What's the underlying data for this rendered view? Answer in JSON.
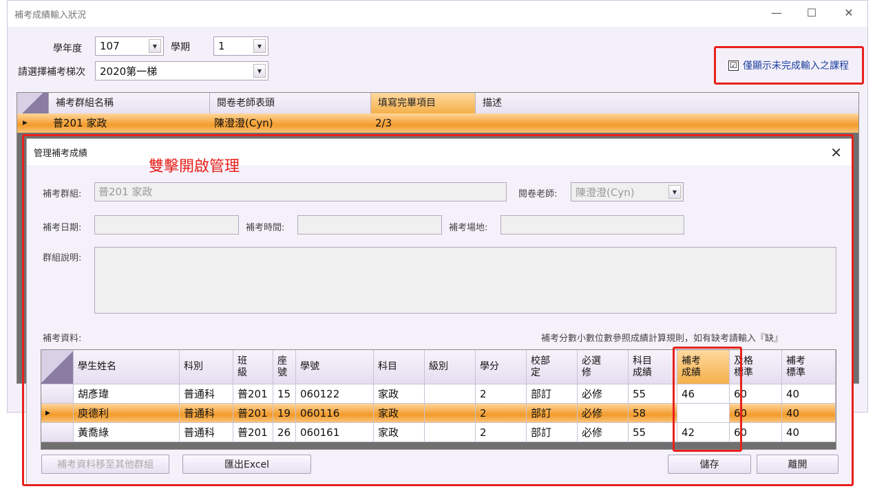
{
  "window": {
    "title": "補考成績輸入狀況",
    "minimize": "—",
    "maximize": "☐",
    "close": "✕"
  },
  "filters": {
    "year_label": "學年度",
    "year_value": "107",
    "semester_label": "學期",
    "semester_value": "1",
    "batch_label": "請選擇補考梯次",
    "batch_value": "2020第一梯",
    "only_incomplete_label": "僅顯示未完成輸入之課程",
    "only_incomplete_checked": "☑"
  },
  "outer_grid": {
    "columns": [
      "補考群組名稱",
      "閱卷老師表頭",
      "填寫完畢項目",
      "描述"
    ],
    "rows": [
      {
        "group": "普201 家政",
        "teacher": "陳澄澄(Cyn)",
        "done": "2/3",
        "desc": ""
      }
    ]
  },
  "dialog": {
    "title": "管理補考成績",
    "close": "✕",
    "annotation": "雙擊開啟管理",
    "group_label": "補考群組:",
    "group_value": "普201 家政",
    "grader_label": "閱卷老師:",
    "grader_value": "陳澄澄(Cyn)",
    "date_label": "補考日期:",
    "time_label": "補考時間:",
    "place_label": "補考場地:",
    "desc_label": "群組說明:",
    "data_label": "補考資料:",
    "note": "補考分數小數位數參照成績計算規則，如有缺考請輸入『缺』",
    "columns": [
      "學生姓名",
      "科別",
      "班\n級",
      "座\n號",
      "學號",
      "科目",
      "級別",
      "學分",
      "校部\n定",
      "必選\n修",
      "科目\n成績",
      "補考\n成績",
      "及格\n標準",
      "補考\n標準"
    ],
    "rows": [
      {
        "name": "胡彥瑋",
        "dept": "普通科",
        "class": "普201",
        "seat": "15",
        "sid": "060122",
        "subject": "家政",
        "level": "",
        "credit": "2",
        "type": "部訂",
        "req": "必修",
        "score": "55",
        "makeup": "46",
        "pass": "60",
        "makeup_pass": "40"
      },
      {
        "name": "庾德利",
        "dept": "普通科",
        "class": "普201",
        "seat": "19",
        "sid": "060116",
        "subject": "家政",
        "level": "",
        "credit": "2",
        "type": "部訂",
        "req": "必修",
        "score": "58",
        "makeup": "",
        "pass": "60",
        "makeup_pass": "40"
      },
      {
        "name": "黃喬綠",
        "dept": "普通科",
        "class": "普201",
        "seat": "26",
        "sid": "060161",
        "subject": "家政",
        "level": "",
        "credit": "2",
        "type": "部訂",
        "req": "必修",
        "score": "55",
        "makeup": "42",
        "pass": "60",
        "makeup_pass": "40"
      }
    ],
    "buttons": {
      "move": "補考資料移至其他群組",
      "export": "匯出Excel",
      "save": "儲存",
      "leave": "離開"
    }
  },
  "colors": {
    "highlight": "#e8201b",
    "selected_row": "#f39b2a",
    "accent_text": "#1b3f9e"
  }
}
